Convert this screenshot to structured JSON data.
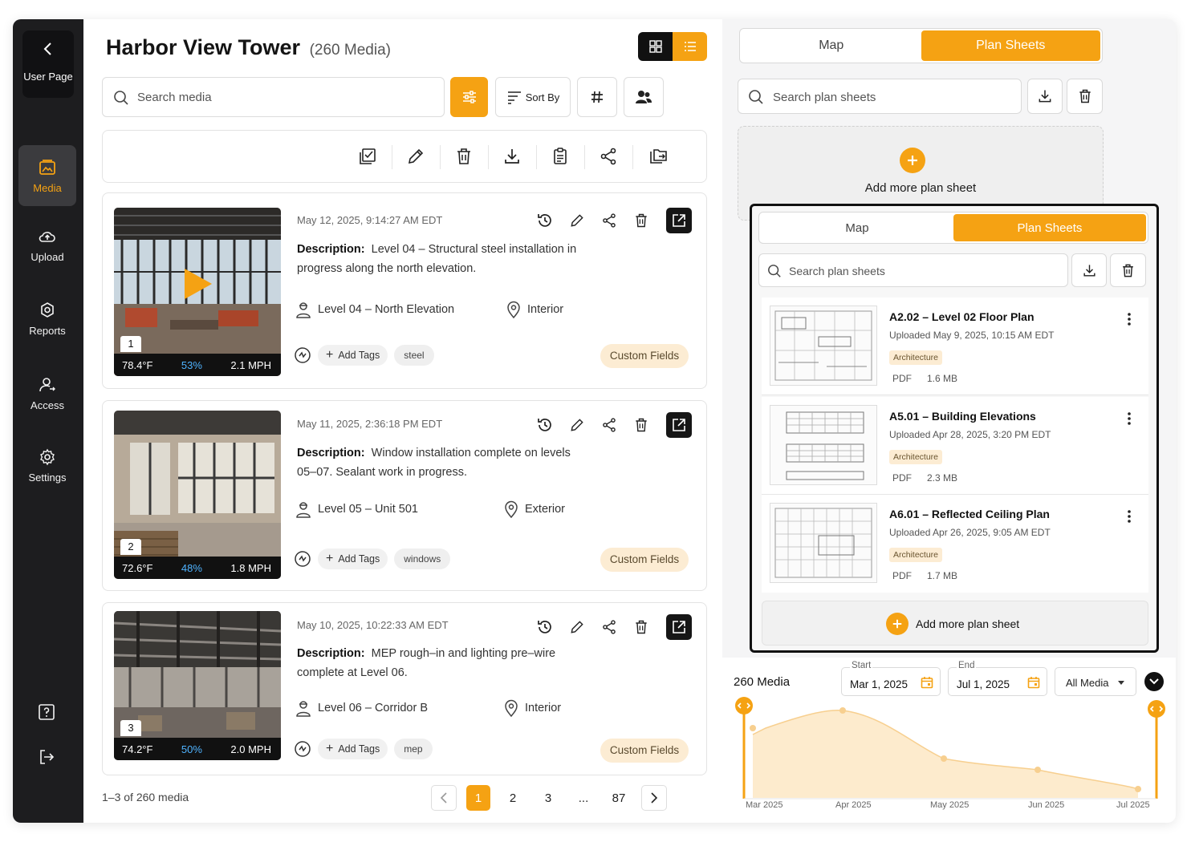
{
  "sidebar": {
    "back_label": "User Page",
    "items": [
      {
        "label": "Media",
        "icon": "media-icon",
        "active": true
      },
      {
        "label": "Upload",
        "icon": "upload-cloud-icon"
      },
      {
        "label": "Reports",
        "icon": "reports-icon"
      },
      {
        "label": "Access",
        "icon": "access-user-icon"
      },
      {
        "label": "Settings",
        "icon": "gear-icon"
      }
    ],
    "bottom_icons": [
      "help-icon",
      "logout-icon"
    ]
  },
  "header": {
    "title": "Harbor View Tower",
    "count": "(260 Media)"
  },
  "toolbar": {
    "search_placeholder": "Search media",
    "sort_label": "Sort By"
  },
  "media": [
    {
      "index": "1",
      "temp": "78.4°F",
      "humidity": "53%",
      "wind": "2.1 MPH",
      "date": "May 12, 2025, 9:14:27 AM EDT",
      "description_label": "Description:",
      "description": "Level 04 – Structural steel installation in progress along the north elevation.",
      "location": "Level 04 – North Elevation",
      "place": "Interior",
      "add_tags": "Add Tags",
      "tag": "steel",
      "custom_fields": "Custom Fields",
      "has_video": true
    },
    {
      "index": "2",
      "temp": "72.6°F",
      "humidity": "48%",
      "wind": "1.8 MPH",
      "date": "May 11, 2025, 2:36:18 PM EDT",
      "description_label": "Description:",
      "description": "Window installation complete on levels 05–07. Sealant work in progress.",
      "location": "Level 05 – Unit 501",
      "place": "Exterior",
      "add_tags": "Add Tags",
      "tag": "windows",
      "custom_fields": "Custom Fields",
      "has_video": false
    },
    {
      "index": "3",
      "temp": "74.2°F",
      "humidity": "50%",
      "wind": "2.0 MPH",
      "date": "May 10, 2025, 10:22:33 AM EDT",
      "description_label": "Description:",
      "description": "MEP rough–in and lighting pre–wire complete at Level 06.",
      "location": "Level 06 – Corridor B",
      "place": "Interior",
      "add_tags": "Add Tags",
      "tag": "mep",
      "custom_fields": "Custom Fields",
      "has_video": false
    }
  ],
  "pagination": {
    "info": "1–3 of 260 media",
    "pages": [
      "1",
      "2",
      "3",
      "...",
      "87"
    ],
    "current": "1"
  },
  "right_panel": {
    "tab_map": "Map",
    "tab_plans": "Plan Sheets",
    "search_placeholder": "Search plan sheets",
    "add_label": "Add more plan sheet"
  },
  "overlay": {
    "tab_map": "Map",
    "tab_plans": "Plan Sheets",
    "search_placeholder": "Search plan sheets",
    "sheets": [
      {
        "title": "A2.02 – Level 02 Floor Plan",
        "uploaded": "Uploaded May 9, 2025, 10:15 AM EDT",
        "category": "Architecture",
        "type": "PDF",
        "size": "1.6 MB"
      },
      {
        "title": "A5.01 – Building Elevations",
        "uploaded": "Uploaded Apr 28, 2025, 3:20 PM EDT",
        "category": "Architecture",
        "type": "PDF",
        "size": "2.3 MB"
      },
      {
        "title": "A6.01 – Reflected Ceiling Plan",
        "uploaded": "Uploaded Apr 26, 2025, 9:05 AM EDT",
        "category": "Architecture",
        "type": "PDF",
        "size": "1.7 MB"
      }
    ],
    "add_label": "Add more plan sheet"
  },
  "timeline": {
    "title": "260 Media",
    "start_label": "Start",
    "start_value": "Mar 1, 2025",
    "end_label": "End",
    "end_value": "Jul 1, 2025",
    "filter": "All Media",
    "x_labels": [
      "Mar 2025",
      "Apr 2025",
      "May 2025",
      "Jun 2025",
      "Jul 2025"
    ]
  },
  "colors": {
    "accent": "#f5a213",
    "sidebar": "#1d1d1f",
    "humidity": "#4fb3ff"
  }
}
